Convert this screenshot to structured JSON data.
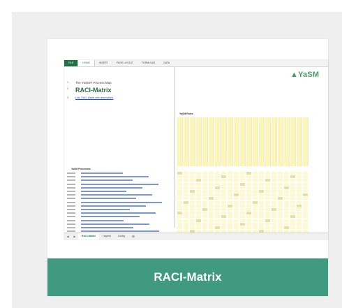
{
  "card": {
    "caption": "RACI-Matrix",
    "colors": {
      "caption_bar": "#3f9a7f",
      "outer_panel": "#efefef"
    }
  },
  "screenshot": {
    "ribbon_tabs": [
      "FILE",
      "HOME",
      "INSERT",
      "PAGE LAYOUT",
      "FORMULAS",
      "DATA"
    ],
    "active_ribbon_tab": "HOME",
    "caption_line": "The YaSM® Process Map",
    "title": "RACI-Matrix",
    "link": "Link: RACI-Matrix with descriptions",
    "logo": "YaSM",
    "roles_heading": "YaSM Roles",
    "processes_heading": "YaSM Processes",
    "sheet_tabs": [
      "RACI-Matrix",
      "Legend",
      "Config"
    ],
    "active_sheet_tab": "RACI-Matrix"
  }
}
